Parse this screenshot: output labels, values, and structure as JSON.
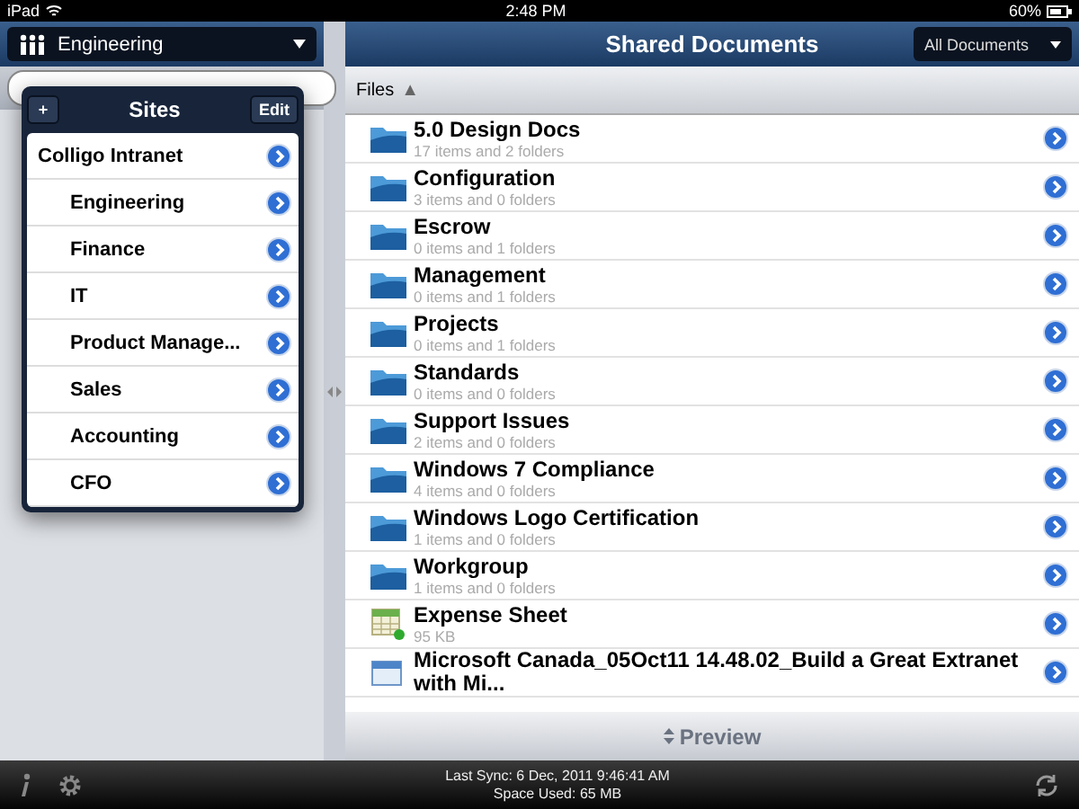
{
  "status_bar": {
    "device": "iPad",
    "time": "2:48 PM",
    "battery": "60%"
  },
  "sidebar": {
    "site_selector": "Engineering"
  },
  "sites_popover": {
    "add_button": "+",
    "title": "Sites",
    "edit_button": "Edit",
    "items": [
      {
        "label": "Colligo Intranet",
        "children": [
          {
            "label": "Engineering"
          },
          {
            "label": "Finance"
          },
          {
            "label": "IT"
          },
          {
            "label": "Product Manage..."
          },
          {
            "label": "Sales"
          },
          {
            "label": "Accounting"
          },
          {
            "label": "CFO"
          }
        ]
      }
    ]
  },
  "library": {
    "title": "Shared Documents",
    "view_selector": "All Documents",
    "column": "Files",
    "sort_indicator": "▲"
  },
  "files": [
    {
      "kind": "folder",
      "name": "5.0 Design Docs",
      "details": "17 items and 2 folders"
    },
    {
      "kind": "folder",
      "name": "Configuration",
      "details": "3 items and 0 folders"
    },
    {
      "kind": "folder",
      "name": "Escrow",
      "details": "0 items and 1 folders"
    },
    {
      "kind": "folder",
      "name": "Management",
      "details": "0 items and 1 folders"
    },
    {
      "kind": "folder",
      "name": "Projects",
      "details": "0 items and 1 folders"
    },
    {
      "kind": "folder",
      "name": "Standards",
      "details": "0 items and 0 folders"
    },
    {
      "kind": "folder",
      "name": "Support Issues",
      "details": "2 items and 0 folders"
    },
    {
      "kind": "folder",
      "name": "Windows 7 Compliance",
      "details": "4 items and 0 folders"
    },
    {
      "kind": "folder",
      "name": "Windows Logo Certification",
      "details": "1 items and 0 folders"
    },
    {
      "kind": "folder",
      "name": "Workgroup",
      "details": "1 items and 0 folders"
    },
    {
      "kind": "spreadsheet",
      "name": "Expense Sheet",
      "details": "95 KB"
    },
    {
      "kind": "document",
      "name": "Microsoft Canada_05Oct11 14.48.02_Build a Great Extranet with Mi..."
    }
  ],
  "preview_button": "Preview",
  "footer": {
    "last_sync": "Last Sync: 6 Dec, 2011 9:46:41 AM",
    "space_used": "Space Used: 65 MB"
  }
}
